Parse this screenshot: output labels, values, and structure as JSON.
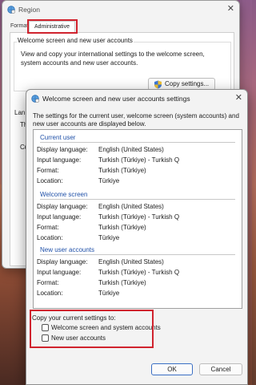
{
  "region": {
    "title": "Region",
    "close_glyph": "✕",
    "tabs": [
      "Formats",
      "Administrative"
    ],
    "group_title": "Welcome screen and new user accounts",
    "description": "View and copy your international settings to the welcome screen, system accounts and new user accounts.",
    "copy_button": "Copy settings...",
    "fragments": [
      "Lan",
      "Th",
      "Cu"
    ]
  },
  "dialog": {
    "title": "Welcome screen and new user accounts settings",
    "close_glyph": "✕",
    "intro": "The settings for the current user, welcome screen (system accounts) and new user accounts are displayed below.",
    "sections": [
      {
        "heading": "Current user",
        "rows": [
          {
            "label": "Display language:",
            "value": "English (United States)"
          },
          {
            "label": "Input language:",
            "value": "Turkish (Türkiye) - Turkish Q"
          },
          {
            "label": "Format:",
            "value": "Turkish (Türkiye)"
          },
          {
            "label": "Location:",
            "value": "Türkiye"
          }
        ]
      },
      {
        "heading": "Welcome screen",
        "rows": [
          {
            "label": "Display language:",
            "value": "English (United States)"
          },
          {
            "label": "Input language:",
            "value": "Turkish (Türkiye) - Turkish Q"
          },
          {
            "label": "Format:",
            "value": "Turkish (Türkiye)"
          },
          {
            "label": "Location:",
            "value": "Türkiye"
          }
        ]
      },
      {
        "heading": "New user accounts",
        "rows": [
          {
            "label": "Display language:",
            "value": "English (United States)"
          },
          {
            "label": "Input language:",
            "value": "Turkish (Türkiye) - Turkish Q"
          },
          {
            "label": "Format:",
            "value": "Turkish (Türkiye)"
          },
          {
            "label": "Location:",
            "value": "Türkiye"
          }
        ]
      }
    ],
    "copy_title": "Copy your current settings to:",
    "checkboxes": [
      {
        "label": "Welcome screen and system accounts",
        "checked": false
      },
      {
        "label": "New user accounts",
        "checked": false
      }
    ],
    "ok_label": "OK",
    "cancel_label": "Cancel"
  },
  "icons": {
    "app": "globe-clock-icon",
    "admin": "uac-shield-icon"
  },
  "colors": {
    "highlight": "#d0232e",
    "section_heading": "#1f50a8",
    "primary_border": "#3a6fc4"
  }
}
